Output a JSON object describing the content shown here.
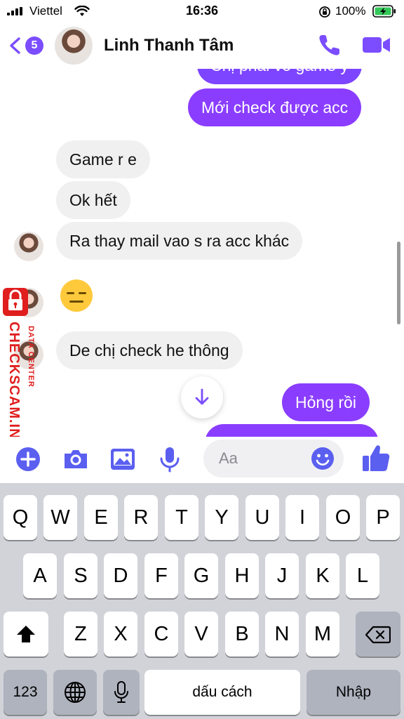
{
  "status_bar": {
    "carrier": "Viettel",
    "time": "16:36",
    "battery": "100%"
  },
  "header": {
    "unread_count": "5",
    "contact_name": "Linh Thanh Tâm"
  },
  "messages": {
    "partial_top": "Chị phải vô game ý",
    "m1": "Mới check được acc",
    "m2": "Game r e",
    "m3": "Ok hết",
    "m4": "Ra thay mail vao s ra acc khác",
    "m5_emoji": "expressionless-face",
    "m6": "De chị check he thông",
    "m7": "Hỏng rồi"
  },
  "watermark": {
    "main": "CHECKSCAM.INFO",
    "sub": "DATA CENTER"
  },
  "composer": {
    "placeholder": "Aa"
  },
  "keyboard": {
    "row1": [
      "Q",
      "W",
      "E",
      "R",
      "T",
      "Y",
      "U",
      "I",
      "O",
      "P"
    ],
    "row2": [
      "A",
      "S",
      "D",
      "F",
      "G",
      "H",
      "J",
      "K",
      "L"
    ],
    "row3": [
      "Z",
      "X",
      "C",
      "V",
      "B",
      "N",
      "M"
    ],
    "numbers_key": "123",
    "space_key": "dấu cách",
    "return_key": "Nhập"
  },
  "colors": {
    "accent": "#8a3dff",
    "incoming_bubble": "#f0f0f0",
    "keyboard_bg": "#d1d3d9"
  }
}
